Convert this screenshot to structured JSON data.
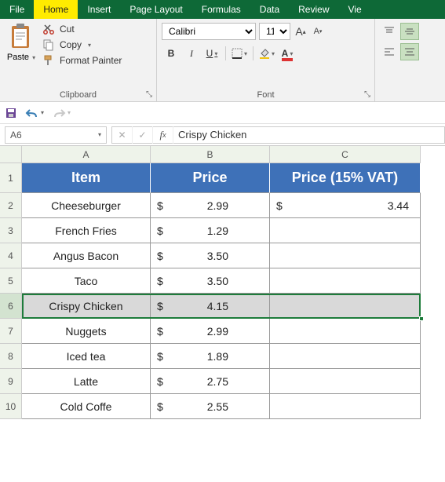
{
  "tabs": {
    "file": "File",
    "home": "Home",
    "insert": "Insert",
    "pagelayout": "Page Layout",
    "formulas": "Formulas",
    "data": "Data",
    "review": "Review",
    "view": "Vie"
  },
  "ribbon": {
    "clipboard": {
      "label": "Clipboard",
      "paste": "Paste",
      "cut": "Cut",
      "copy": "Copy",
      "fmt": "Format Painter"
    },
    "font": {
      "label": "Font",
      "name": "Calibri",
      "size": "11"
    }
  },
  "name_box": "A6",
  "formula_bar": "Crispy Chicken",
  "columns": {
    "A": "A",
    "B": "B",
    "C": "C"
  },
  "headers": {
    "item": "Item",
    "price": "Price",
    "vat": "Price (15% VAT)"
  },
  "rows": [
    {
      "n": "2",
      "item": "Cheeseburger",
      "cur": "$",
      "price": "2.99",
      "vcur": "$",
      "vat": "3.44"
    },
    {
      "n": "3",
      "item": "French Fries",
      "cur": "$",
      "price": "1.29",
      "vcur": "",
      "vat": ""
    },
    {
      "n": "4",
      "item": "Angus Bacon",
      "cur": "$",
      "price": "3.50",
      "vcur": "",
      "vat": ""
    },
    {
      "n": "5",
      "item": "Taco",
      "cur": "$",
      "price": "3.50",
      "vcur": "",
      "vat": ""
    },
    {
      "n": "6",
      "item": "Crispy Chicken",
      "cur": "$",
      "price": "4.15",
      "vcur": "",
      "vat": ""
    },
    {
      "n": "7",
      "item": "Nuggets",
      "cur": "$",
      "price": "2.99",
      "vcur": "",
      "vat": ""
    },
    {
      "n": "8",
      "item": "Iced tea",
      "cur": "$",
      "price": "1.89",
      "vcur": "",
      "vat": ""
    },
    {
      "n": "9",
      "item": "Latte",
      "cur": "$",
      "price": "2.75",
      "vcur": "",
      "vat": ""
    },
    {
      "n": "10",
      "item": "Cold Coffe",
      "cur": "$",
      "price": "2.55",
      "vcur": "",
      "vat": ""
    }
  ],
  "colors": {
    "accent": "#0e6937",
    "header": "#3e71b8"
  }
}
